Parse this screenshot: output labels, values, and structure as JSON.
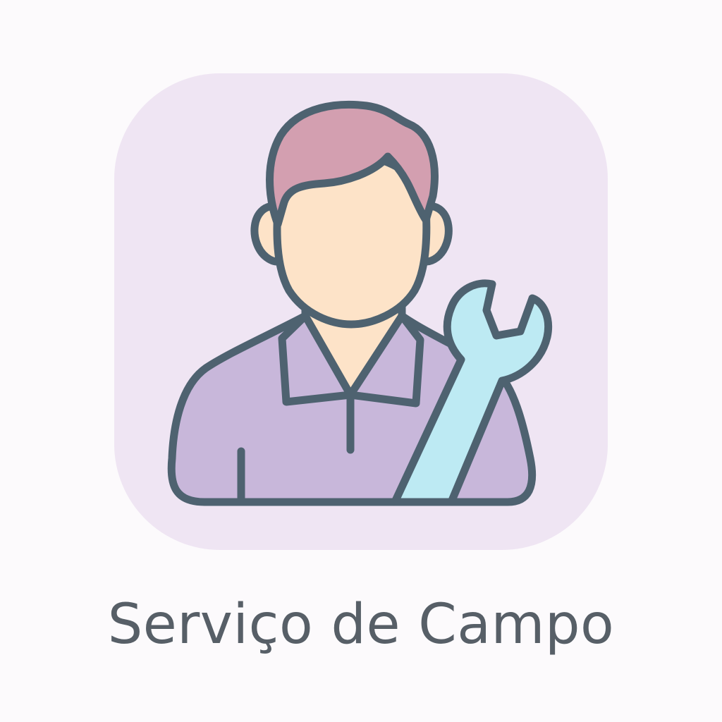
{
  "app": {
    "label": "Serviço de Campo",
    "icon": "field-service-technician-icon"
  },
  "icon_parts": {
    "person": "technician-person-icon",
    "tool": "wrench-icon"
  },
  "colors": {
    "page_background": "#fcfafc",
    "tile_background": "#efe5f3",
    "outline": "#4e6270",
    "hair": "#d39fb0",
    "skin": "#fde3c8",
    "shirt": "#c8b7da",
    "wrench": "#bdeaf3",
    "label_text": "#575f67"
  }
}
